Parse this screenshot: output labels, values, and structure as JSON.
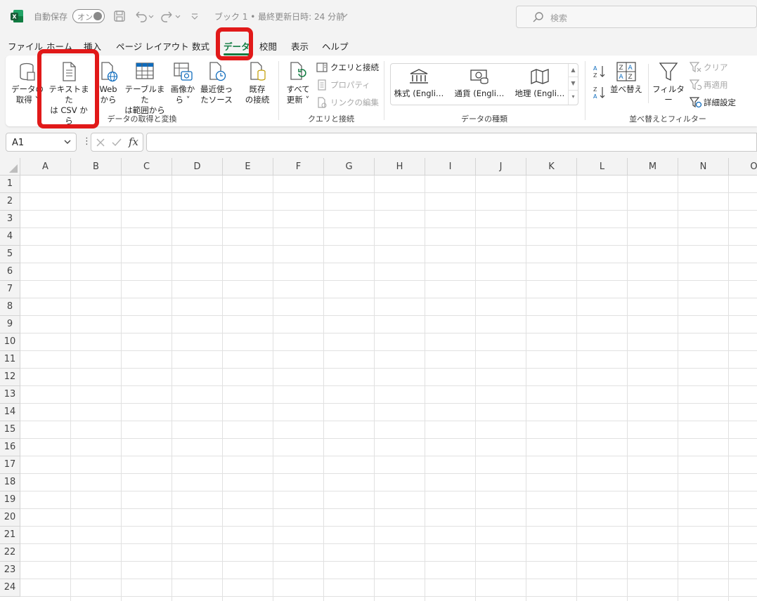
{
  "titlebar": {
    "autosave_label": "自動保存",
    "autosave_state": "オン",
    "doc_title": "ブック 1 • 最終更新日時: 24 分前",
    "search_placeholder": "検索"
  },
  "menu": {
    "tabs": [
      "ファイル",
      "ホーム",
      "挿入",
      "ページ レイアウト",
      "数式",
      "データ",
      "校閲",
      "表示",
      "ヘルプ"
    ],
    "active_index": 5
  },
  "ribbon": {
    "get_transform": {
      "get_data": [
        "データの",
        "取得 ˅"
      ],
      "text_csv": [
        "テキストまた",
        "は CSV から"
      ],
      "web": [
        "Web",
        "から"
      ],
      "table_range": [
        "テーブルまた",
        "は範囲から"
      ],
      "image": [
        "画像か",
        "ら ˅"
      ],
      "recent": [
        "最近使っ",
        "たソース"
      ],
      "existing": [
        "既存",
        "の接続"
      ],
      "label": "データの取得と変換"
    },
    "queries": {
      "refresh": [
        "すべて",
        "更新 ˅"
      ],
      "queries_connections": "クエリと接続",
      "properties": "プロパティ",
      "edit_links": "リンクの編集",
      "label": "クエリと接続"
    },
    "datatypes": {
      "stocks": "株式 (Engli…",
      "currency": "通貨 (Engli…",
      "geography": "地理 (Engli…",
      "label": "データの種類"
    },
    "sort_filter": {
      "sort": "並べ替え",
      "filter": "フィルター",
      "clear": "クリア",
      "reapply": "再適用",
      "advanced": "詳細設定",
      "label": "並べ替えとフィルター"
    }
  },
  "formula_bar": {
    "namebox": "A1",
    "fx": "fx",
    "formula": ""
  },
  "grid": {
    "columns": [
      "A",
      "B",
      "C",
      "D",
      "E",
      "F",
      "G",
      "H",
      "I",
      "J",
      "K",
      "L",
      "M",
      "N",
      "O"
    ],
    "rows": [
      "1",
      "2",
      "3",
      "4",
      "5",
      "6",
      "7",
      "8",
      "9",
      "10",
      "11",
      "12",
      "13",
      "14",
      "15",
      "16",
      "17",
      "18",
      "19",
      "20",
      "21",
      "22",
      "23",
      "24"
    ]
  },
  "colors": {
    "accent": "#107c41",
    "highlight": "#e11919"
  }
}
